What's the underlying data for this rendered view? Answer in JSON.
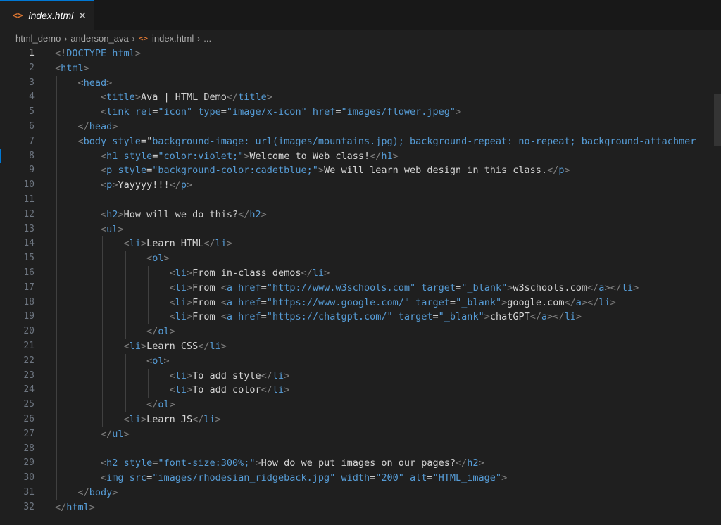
{
  "tab": {
    "label": "index.html",
    "icon": "html-file-icon",
    "close": "✕"
  },
  "breadcrumb": [
    "html_demo",
    "anderson_ava",
    "index.html",
    "..."
  ],
  "active_line": 1,
  "swatches": {
    "violet": "#ee82ee",
    "cadetblue": "#5f9ea0"
  },
  "lines": [
    {
      "n": "1",
      "text": "<!DOCTYPE html>"
    },
    {
      "n": "2",
      "text": "<html>"
    },
    {
      "n": "3",
      "text": "    <head>"
    },
    {
      "n": "4",
      "text": "        <title>Ava | HTML Demo</title>"
    },
    {
      "n": "5",
      "text": "        <link rel=\"icon\" type=\"image/x-icon\" href=\"images/flower.jpeg\">"
    },
    {
      "n": "6",
      "text": "    </head>"
    },
    {
      "n": "7",
      "text": "    <body style=\"background-image: url(images/mountains.jpg); background-repeat: no-repeat; background-attachmer"
    },
    {
      "n": "8",
      "text": "        <h1 style=\"color:violet;\">Welcome to Web class!</h1>"
    },
    {
      "n": "9",
      "text": "        <p style=\"background-color:cadetblue;\">We will learn web design in this class.</p>"
    },
    {
      "n": "10",
      "text": "        <p>Yayyyy!!!</p>"
    },
    {
      "n": "11",
      "text": ""
    },
    {
      "n": "12",
      "text": "        <h2>How will we do this?</h2>"
    },
    {
      "n": "13",
      "text": "        <ul>"
    },
    {
      "n": "14",
      "text": "            <li>Learn HTML</li>"
    },
    {
      "n": "15",
      "text": "                <ol>"
    },
    {
      "n": "16",
      "text": "                    <li>From in-class demos</li>"
    },
    {
      "n": "17",
      "text": "                    <li>From <a href=\"http://www.w3schools.com\" target=\"_blank\">w3schools.com</a></li>"
    },
    {
      "n": "18",
      "text": "                    <li>From <a href=\"https://www.google.com/\" target=\"_blank\">google.com</a></li>"
    },
    {
      "n": "19",
      "text": "                    <li>From <a href=\"https://chatgpt.com/\" target=\"_blank\">chatGPT</a></li>"
    },
    {
      "n": "20",
      "text": "                </ol>"
    },
    {
      "n": "21",
      "text": "            <li>Learn CSS</li>"
    },
    {
      "n": "22",
      "text": "                <ol>"
    },
    {
      "n": "23",
      "text": "                    <li>To add style</li>"
    },
    {
      "n": "24",
      "text": "                    <li>To add color</li>"
    },
    {
      "n": "25",
      "text": "                </ol>"
    },
    {
      "n": "26",
      "text": "            <li>Learn JS</li>"
    },
    {
      "n": "27",
      "text": "        </ul>"
    },
    {
      "n": "28",
      "text": ""
    },
    {
      "n": "29",
      "text": "        <h2 style=\"font-size:300%;\">How do we put images on our pages?</h2>"
    },
    {
      "n": "30",
      "text": "        <img src=\"images/rhodesian_ridgeback.jpg\" width=\"200\" alt=\"HTML_image\">"
    },
    {
      "n": "31",
      "text": "    </body>"
    },
    {
      "n": "32",
      "text": "</html>"
    }
  ]
}
